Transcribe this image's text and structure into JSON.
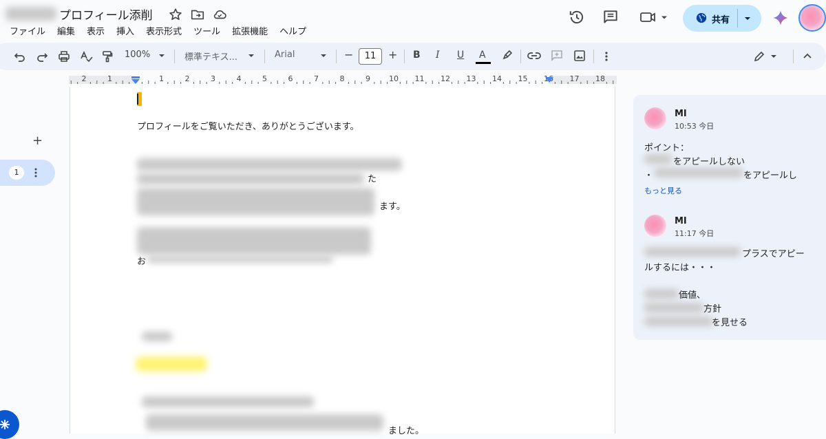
{
  "document": {
    "title": "プロフィール添削"
  },
  "menu": [
    "ファイル",
    "編集",
    "表示",
    "挿入",
    "表示形式",
    "ツール",
    "拡張機能",
    "ヘルプ"
  ],
  "header": {
    "share_label": "共有"
  },
  "toolbar": {
    "zoom": "100%",
    "style": "標準テキス...",
    "font": "Arial",
    "font_size": "11",
    "font_size_minus": "−",
    "font_size_plus": "+",
    "bold": "B",
    "italic": "I",
    "underline": "U",
    "text_color": "A"
  },
  "ruler": {
    "ticks": [
      "2",
      "1",
      "1",
      "2",
      "3",
      "4",
      "5",
      "6",
      "7",
      "8",
      "9",
      "10",
      "11",
      "12",
      "13",
      "14",
      "15",
      "16",
      "17",
      "18"
    ]
  },
  "doc_body": {
    "greeting": "プロフィールをご覧いただき、ありがとうございます。",
    "line_fragment_1": "た",
    "line_fragment_2": "ます。",
    "line_fragment_3": "お",
    "line_fragment_4": "ました。"
  },
  "sidebar": {
    "tab_badge": "1",
    "add_label": "+"
  },
  "comments": [
    {
      "author": "MI",
      "time": "10:53 今日",
      "lines": [
        "ポイント：",
        "をアピールしない",
        "・",
        "をアピールし"
      ],
      "more": "もっと見る"
    },
    {
      "author": "MI",
      "time": "11:17 今日",
      "lines": [
        "プラスでアピー",
        "ルするには・・・",
        "価値、",
        "方針",
        "を見せる"
      ]
    }
  ],
  "colors": {
    "accent": "#0b57d0",
    "share_bg": "#c2e7ff",
    "cursor": "#f4b400",
    "highlight": "#fff475"
  }
}
